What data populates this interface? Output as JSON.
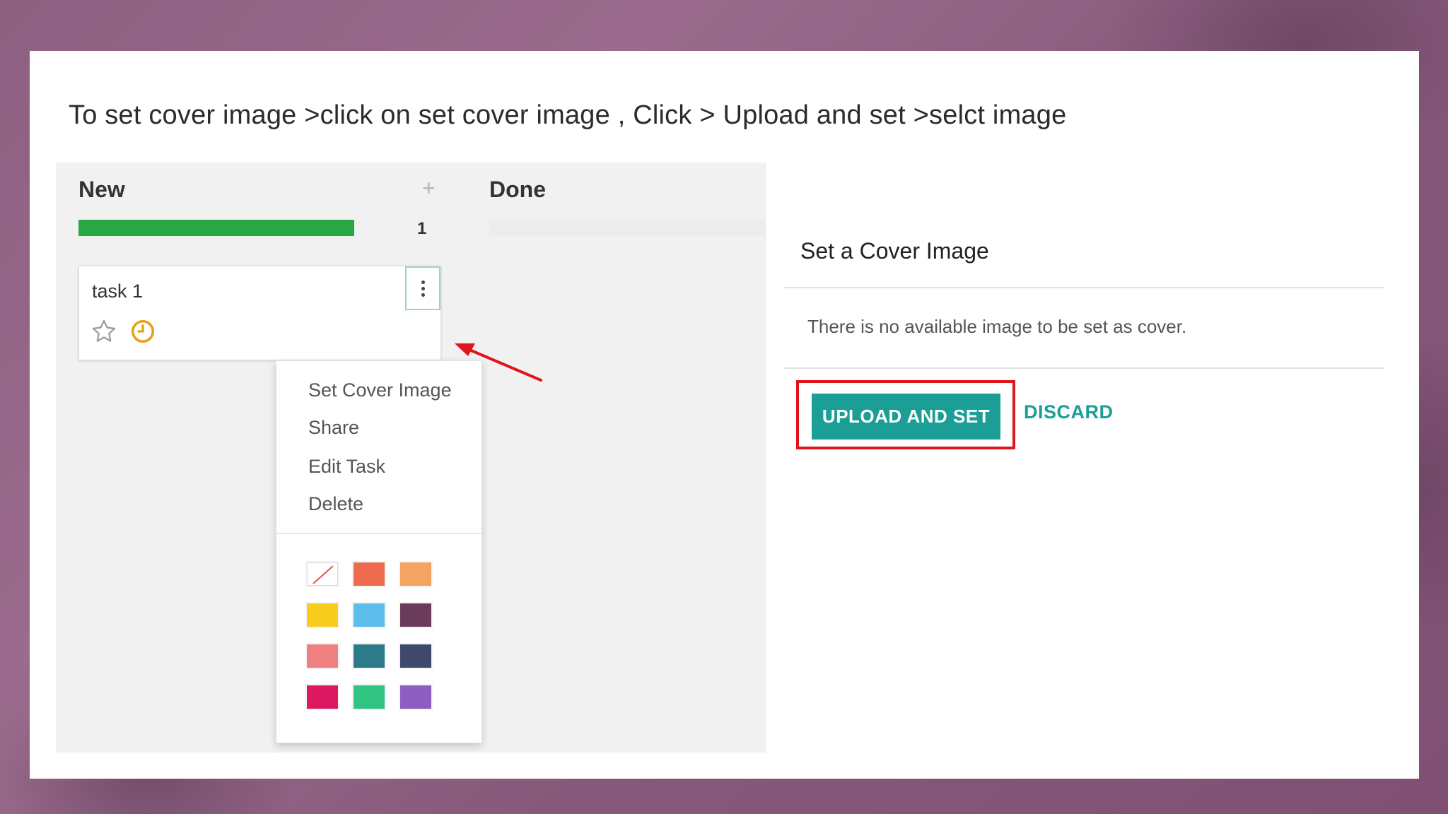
{
  "instruction": "To set cover image >click on set cover image , Click > Upload and set >selct image",
  "kanban": {
    "columns": [
      {
        "title": "New",
        "count": "1",
        "add_icon": "+"
      },
      {
        "title": "Done"
      }
    ],
    "card": {
      "title": "task 1",
      "icons": [
        "star-icon",
        "clock-icon",
        "kebab-menu-icon"
      ]
    },
    "dropdown": {
      "items": [
        "Set Cover Image",
        "Share",
        "Edit Task",
        "Delete"
      ],
      "colors": [
        "none",
        "#ee6c4d",
        "#f4a460",
        "#f9cd1e",
        "#5cbdea",
        "#6b3b5b",
        "#f08080",
        "#2c7b8a",
        "#3d4a6b",
        "#dc1860",
        "#30c381",
        "#8e5dc2"
      ]
    }
  },
  "dialog": {
    "title": "Set a Cover Image",
    "body": "There is no available image to be set as cover.",
    "upload_label": "UPLOAD AND SET",
    "discard_label": "DISCARD"
  },
  "colors": {
    "progress_green": "#28a745",
    "primary_teal": "#1b9e95",
    "annotation_red": "#e0141c",
    "clock_orange": "#e5a21b"
  }
}
